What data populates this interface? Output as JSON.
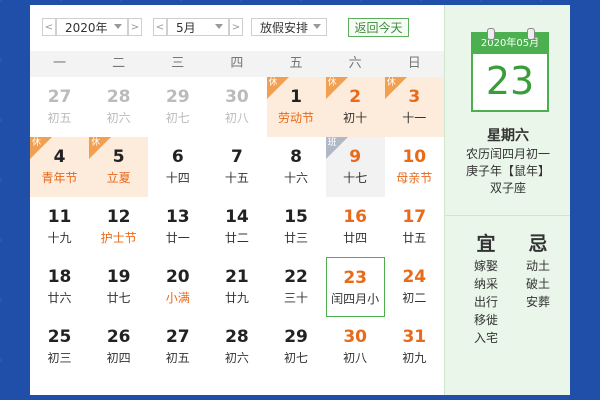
{
  "toolbar": {
    "year": "2020年",
    "month": "5月",
    "holiday": "放假安排",
    "today_button": "返回今天",
    "prev": "<",
    "next": ">"
  },
  "weekdays": [
    "一",
    "二",
    "三",
    "四",
    "五",
    "六",
    "日"
  ],
  "weeks": [
    [
      {
        "day": "27",
        "sub": "初五",
        "other": true
      },
      {
        "day": "28",
        "sub": "初六",
        "other": true
      },
      {
        "day": "29",
        "sub": "初七",
        "other": true
      },
      {
        "day": "30",
        "sub": "初八",
        "other": true
      },
      {
        "day": "1",
        "sub": "劳动节",
        "holiday": true,
        "badge": "休",
        "fest": true
      },
      {
        "day": "2",
        "sub": "初十",
        "holiday": true,
        "badge": "休",
        "weekend": true
      },
      {
        "day": "3",
        "sub": "十一",
        "holiday": true,
        "badge": "休",
        "weekend": true
      }
    ],
    [
      {
        "day": "4",
        "sub": "青年节",
        "holiday": true,
        "badge": "休",
        "fest": true
      },
      {
        "day": "5",
        "sub": "立夏",
        "holiday": true,
        "badge": "休",
        "fest": true
      },
      {
        "day": "6",
        "sub": "十四"
      },
      {
        "day": "7",
        "sub": "十五"
      },
      {
        "day": "8",
        "sub": "十六"
      },
      {
        "day": "9",
        "sub": "十七",
        "work": true,
        "badge": "班",
        "weekend": true
      },
      {
        "day": "10",
        "sub": "母亲节",
        "weekend": true,
        "fest": true
      }
    ],
    [
      {
        "day": "11",
        "sub": "十九"
      },
      {
        "day": "12",
        "sub": "护士节",
        "fest": true
      },
      {
        "day": "13",
        "sub": "廿一"
      },
      {
        "day": "14",
        "sub": "廿二"
      },
      {
        "day": "15",
        "sub": "廿三"
      },
      {
        "day": "16",
        "sub": "廿四",
        "weekend": true
      },
      {
        "day": "17",
        "sub": "廿五",
        "weekend": true
      }
    ],
    [
      {
        "day": "18",
        "sub": "廿六"
      },
      {
        "day": "19",
        "sub": "廿七"
      },
      {
        "day": "20",
        "sub": "小满",
        "fest": true
      },
      {
        "day": "21",
        "sub": "廿九"
      },
      {
        "day": "22",
        "sub": "三十"
      },
      {
        "day": "23",
        "sub": "闰四月小",
        "weekend": true,
        "selected": true
      },
      {
        "day": "24",
        "sub": "初二",
        "weekend": true
      }
    ],
    [
      {
        "day": "25",
        "sub": "初三"
      },
      {
        "day": "26",
        "sub": "初四"
      },
      {
        "day": "27",
        "sub": "初五"
      },
      {
        "day": "28",
        "sub": "初六"
      },
      {
        "day": "29",
        "sub": "初七"
      },
      {
        "day": "30",
        "sub": "初八",
        "weekend": true
      },
      {
        "day": "31",
        "sub": "初九",
        "weekend": true
      }
    ]
  ],
  "panel": {
    "card_header": "2020年05月",
    "card_day": "23",
    "weekday": "星期六",
    "lunar": "农历闰四月初一",
    "ganzhi": "庚子年【鼠年】",
    "zodiac": "双子座",
    "yi_title": "宜",
    "ji_title": "忌",
    "yi": [
      "嫁娶",
      "纳采",
      "出行",
      "移徙",
      "入宅"
    ],
    "ji": [
      "动土",
      "破土",
      "安葬"
    ]
  },
  "colors": {
    "accent_green": "#4caf50",
    "holiday_orange": "#e86a1a",
    "holiday_bg": "#fdebdc",
    "background_blue": "#1f4fa8"
  }
}
